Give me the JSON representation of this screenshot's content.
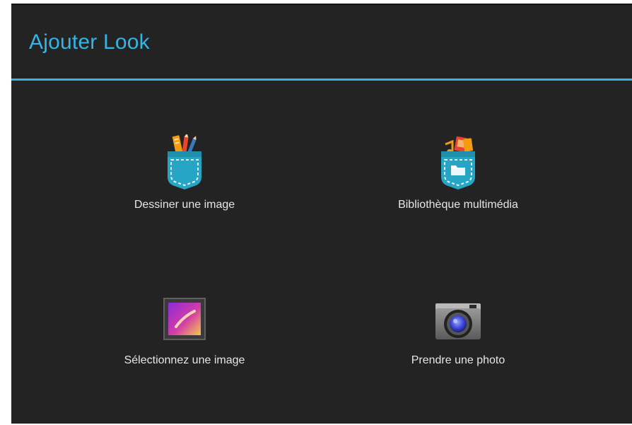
{
  "dialog": {
    "title": "Ajouter Look",
    "accent_color": "#33b5e5",
    "background_color": "#232323"
  },
  "options": [
    {
      "label": "Dessiner une image",
      "icon": "pocket-pencils-icon"
    },
    {
      "label": "Bibliothèque multimédia",
      "icon": "pocket-media-icon"
    },
    {
      "label": "Sélectionnez une image",
      "icon": "gallery-image-icon"
    },
    {
      "label": "Prendre une photo",
      "icon": "camera-icon"
    }
  ]
}
